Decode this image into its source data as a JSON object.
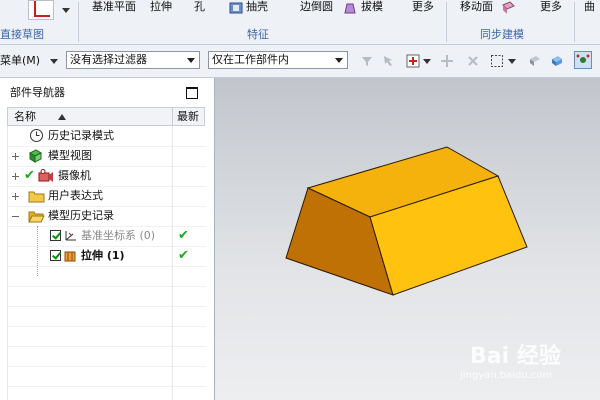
{
  "ribbon": {
    "sketch_group": "直接草图",
    "feature_group": "特征",
    "sync_group": "同步建模",
    "datum_plane": "基准平面",
    "extrude": "拉伸",
    "hole": "孔",
    "shell": "抽壳",
    "edge_blend": "边倒圆",
    "draft": "拔模",
    "more1": "更多",
    "move_face": "移动面",
    "more2": "更多",
    "curve_tab": "曲"
  },
  "toolbar": {
    "menu_label": "菜单(M)",
    "filter_value": "没有选择过滤器",
    "scope_value": "仅在工作部件内"
  },
  "navigator": {
    "title": "部件导航器",
    "col_name": "名称",
    "col_latest": "最新",
    "items": [
      {
        "label": "历史记录模式"
      },
      {
        "label": "模型视图"
      },
      {
        "label": "摄像机"
      },
      {
        "label": "用户表达式"
      },
      {
        "label": "模型历史记录"
      },
      {
        "label": "基准坐标系 (0)"
      },
      {
        "label": "拉伸 (1)"
      }
    ]
  },
  "viewport": {
    "model_color": "#ffc20e"
  },
  "watermark": {
    "brand": "Bai  经验",
    "url": "jingyan.baidu.com"
  }
}
